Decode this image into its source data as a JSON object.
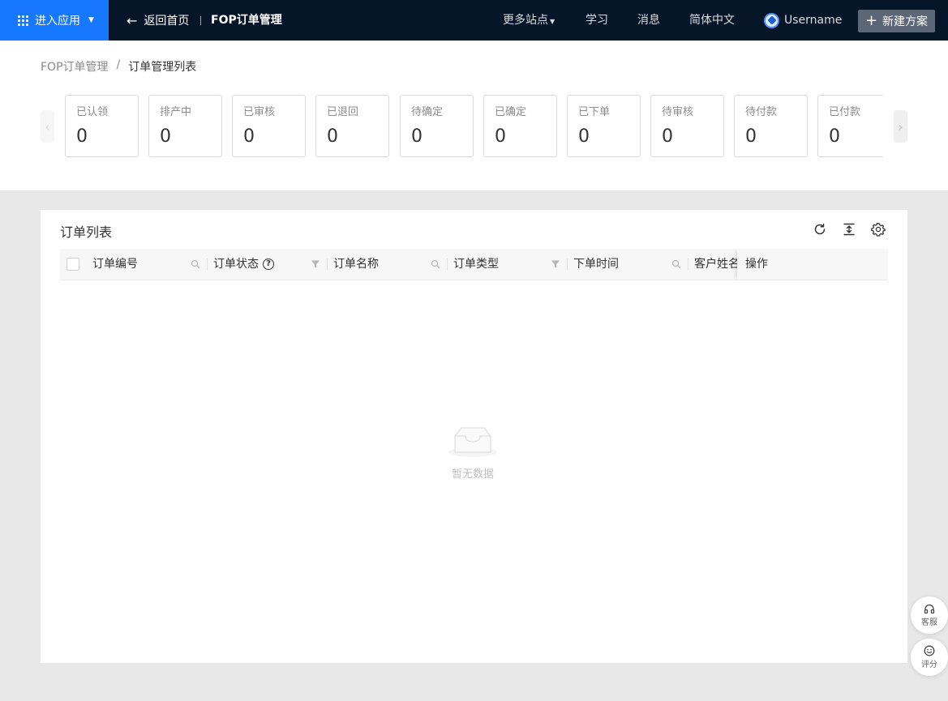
{
  "topbar": {
    "apps_label": "进入应用",
    "back_label": "返回首页",
    "app_title": "FOP订单管理",
    "nav": {
      "more_sites": "更多站点",
      "learn": "学习",
      "messages": "消息",
      "language": "简体中文"
    },
    "username": "Username",
    "new_plan_label": "新建方案"
  },
  "breadcrumb": {
    "root": "FOP订单管理",
    "separator": "/",
    "current": "订单管理列表"
  },
  "status_cards": [
    {
      "label": "已认领",
      "value": "0"
    },
    {
      "label": "排产中",
      "value": "0"
    },
    {
      "label": "已审核",
      "value": "0"
    },
    {
      "label": "已退回",
      "value": "0"
    },
    {
      "label": "待确定",
      "value": "0"
    },
    {
      "label": "已确定",
      "value": "0"
    },
    {
      "label": "已下单",
      "value": "0"
    },
    {
      "label": "待审核",
      "value": "0"
    },
    {
      "label": "待付款",
      "value": "0"
    },
    {
      "label": "已付款",
      "value": "0"
    }
  ],
  "order_list": {
    "title": "订单列表",
    "columns": {
      "order_no": "订单编号",
      "order_status": "订单状态",
      "order_name": "订单名称",
      "order_type": "订单类型",
      "order_time": "下单时间",
      "customer_name": "客户姓名",
      "actions": "操作"
    },
    "empty_text": "暂无数据"
  },
  "float": {
    "support": "客服",
    "rate": "评分"
  },
  "colors": {
    "topbar_bg": "#061528",
    "accent": "#1677ff",
    "new_plan_bg": "#5b6677"
  }
}
